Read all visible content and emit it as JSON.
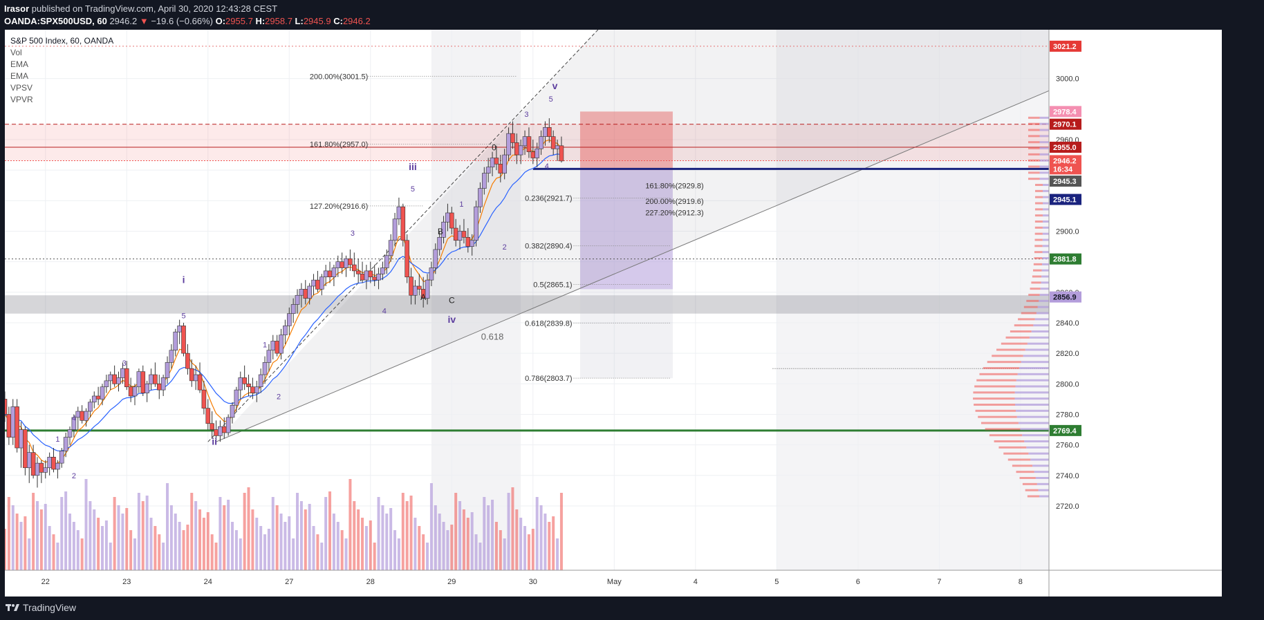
{
  "header": {
    "author": "Irasor",
    "published_text": "published on TradingView.com, April 30, 2020 12:43:28 CEST",
    "symbol": "OANDA:SPX500USD, 60",
    "last": "2946.2",
    "change_arrow": "▼",
    "change": "−19.6 (−0.66%)",
    "o_label": "O:",
    "o": "2955.7",
    "h_label": "H:",
    "h": "2958.7",
    "l_label": "L:",
    "l": "2945.9",
    "c_label": "C:",
    "c": "2946.2"
  },
  "legend": {
    "title": "S&P 500 Index, 60, OANDA",
    "indicators": [
      "Vol",
      "EMA",
      "EMA",
      "VPSV",
      "VPVR"
    ]
  },
  "footer": {
    "brand": "TradingView"
  },
  "colors": {
    "up": "#b39ddb",
    "down": "#ef5350",
    "wave": "#5c3d9e",
    "ema_fast": "#f57c00",
    "ema_slow": "#2962ff",
    "green_line": "#2e7d32",
    "navy_line": "#1a237e"
  },
  "chart_data": {
    "type": "candlestick",
    "title": "S&P 500 Index, 60, OANDA",
    "y_axis": {
      "range": [
        2715,
        3032
      ],
      "ticks": [
        2720,
        2740,
        2760,
        2780,
        2800,
        2820,
        2840,
        2860,
        2880,
        2900,
        2920,
        2940,
        2960,
        3000
      ]
    },
    "x_axis": {
      "ticks": [
        {
          "label": "22",
          "day": 0
        },
        {
          "label": "23",
          "day": 1
        },
        {
          "label": "24",
          "day": 2
        },
        {
          "label": "27",
          "day": 3
        },
        {
          "label": "28",
          "day": 4
        },
        {
          "label": "29",
          "day": 5
        },
        {
          "label": "30",
          "day": 6
        },
        {
          "label": "May",
          "day": 7
        },
        {
          "label": "4",
          "day": 8
        },
        {
          "label": "5",
          "day": 9
        },
        {
          "label": "6",
          "day": 10
        },
        {
          "label": "7",
          "day": 11
        },
        {
          "label": "8",
          "day": 12
        }
      ],
      "day_range": [
        -0.5,
        12.35
      ]
    },
    "price_tags": [
      {
        "label": "3021.2",
        "value": 3021.2,
        "bg": "#e53935",
        "fg": "#ffffff"
      },
      {
        "label": "2978.4",
        "value": 2978.4,
        "bg": "#f48fb1",
        "fg": "#ffffff"
      },
      {
        "label": "2970.1",
        "value": 2970.1,
        "bg": "#b71c1c",
        "fg": "#ffffff"
      },
      {
        "label": "2955.0",
        "value": 2955.0,
        "bg": "#b71c1c",
        "fg": "#ffffff"
      },
      {
        "label": "2946.2",
        "value": 2946.2,
        "bg": "#ef5350",
        "fg": "#ffffff"
      },
      {
        "label": "16:34",
        "value": 2940.8,
        "bg": "#ef5350",
        "fg": "#ffffff"
      },
      {
        "label": "2945.3",
        "value": 2932.8,
        "bg": "#555555",
        "fg": "#ffffff"
      },
      {
        "label": "2945.1",
        "value": 2920.8,
        "bg": "#1a237e",
        "fg": "#ffffff"
      },
      {
        "label": "2881.8",
        "value": 2881.8,
        "bg": "#2e7d32",
        "fg": "#ffffff"
      },
      {
        "label": "2856.9",
        "value": 2856.9,
        "bg": "#b39ddb",
        "fg": "#131722"
      },
      {
        "label": "2769.4",
        "value": 2769.4,
        "bg": "#2e7d32",
        "fg": "#ffffff"
      }
    ],
    "fib_levels": [
      {
        "label": "200.00%(3001.5)",
        "value": 3001.5,
        "x0": 3.97,
        "x1": 5.8
      },
      {
        "label": "161.80%(2957.0)",
        "value": 2957.0,
        "x0": 3.97,
        "x1": 5.6
      },
      {
        "label": "127.20%(2916.6)",
        "value": 2916.6,
        "x0": 3.97,
        "x1": 4.65
      },
      {
        "label": "161.80%(2929.8)",
        "value": 2929.8,
        "x0": 7.4,
        "x1": 7.72
      },
      {
        "label": "200.00%(2919.6)",
        "value": 2919.6,
        "x0": 7.4,
        "x1": 7.72
      },
      {
        "label": "227.20%(2912.3)",
        "value": 2912.3,
        "x0": 7.4,
        "x1": 7.72
      },
      {
        "label": "0.236(2921.7)",
        "value": 2921.7,
        "x0": 6.5,
        "x1": 7.7
      },
      {
        "label": "0.382(2890.4)",
        "value": 2890.4,
        "x0": 6.5,
        "x1": 7.7
      },
      {
        "label": "0.5(2865.1)",
        "value": 2865.1,
        "x0": 6.5,
        "x1": 7.7
      },
      {
        "label": "0.618(2839.8)",
        "value": 2839.8,
        "x0": 6.5,
        "x1": 7.7
      },
      {
        "label": "0.786(2803.7)",
        "value": 2803.7,
        "x0": 6.5,
        "x1": 7.7
      }
    ],
    "wave_labels": [
      {
        "text": "i",
        "day": 1.7,
        "value": 2866
      },
      {
        "text": "ii",
        "day": 2.08,
        "value": 2760
      },
      {
        "text": "iii",
        "day": 4.52,
        "value": 2940
      },
      {
        "text": "iv",
        "day": 5.0,
        "value": 2840
      },
      {
        "text": "v",
        "day": 6.27,
        "value": 2993
      },
      {
        "text": "5",
        "day": 1.7,
        "value": 2843
      },
      {
        "text": "3",
        "day": 0.97,
        "value": 2812
      },
      {
        "text": "4",
        "day": 0.35,
        "value": 2776
      },
      {
        "text": "1",
        "day": 0.15,
        "value": 2762
      },
      {
        "text": "2",
        "day": 0.35,
        "value": 2738
      },
      {
        "text": "1",
        "day": 2.7,
        "value": 2824
      },
      {
        "text": "2",
        "day": 2.87,
        "value": 2790
      },
      {
        "text": "3",
        "day": 3.78,
        "value": 2897
      },
      {
        "text": "4",
        "day": 4.17,
        "value": 2846
      },
      {
        "text": "5",
        "day": 4.52,
        "value": 2926
      },
      {
        "text": "1",
        "day": 5.12,
        "value": 2916
      },
      {
        "text": "2",
        "day": 5.65,
        "value": 2888
      },
      {
        "text": "3",
        "day": 5.92,
        "value": 2975
      },
      {
        "text": "4",
        "day": 6.17,
        "value": 2941
      },
      {
        "text": "5",
        "day": 6.22,
        "value": 2985
      }
    ],
    "abc_labels": [
      {
        "text": "A",
        "day": 4.65,
        "value": 2855
      },
      {
        "text": "B",
        "day": 4.86,
        "value": 2898
      },
      {
        "text": "C",
        "day": 5.0,
        "value": 2853
      },
      {
        "text": "0",
        "day": 5.52,
        "value": 2953
      }
    ],
    "fib_0618_label": {
      "text": "0.618",
      "day": 5.5,
      "value": 2829
    },
    "ohlc": [
      [
        -0.5,
        2790,
        2795,
        2775,
        2780
      ],
      [
        -0.45,
        2780,
        2785,
        2760,
        2765
      ],
      [
        -0.4,
        2765,
        2790,
        2760,
        2785
      ],
      [
        -0.35,
        2785,
        2790,
        2755,
        2758
      ],
      [
        -0.3,
        2758,
        2775,
        2745,
        2770
      ],
      [
        -0.25,
        2770,
        2772,
        2740,
        2745
      ],
      [
        -0.2,
        2745,
        2760,
        2735,
        2755
      ],
      [
        -0.15,
        2755,
        2760,
        2738,
        2740
      ],
      [
        -0.1,
        2740,
        2752,
        2732,
        2748
      ],
      [
        -0.05,
        2748,
        2750,
        2735,
        2742
      ],
      [
        0.0,
        2742,
        2750,
        2738,
        2745
      ],
      [
        0.05,
        2745,
        2755,
        2740,
        2752
      ],
      [
        0.1,
        2752,
        2758,
        2742,
        2744
      ],
      [
        0.15,
        2744,
        2750,
        2738,
        2748
      ],
      [
        0.2,
        2748,
        2758,
        2745,
        2756
      ],
      [
        0.25,
        2756,
        2768,
        2752,
        2765
      ],
      [
        0.3,
        2765,
        2772,
        2760,
        2770
      ],
      [
        0.35,
        2770,
        2780,
        2765,
        2778
      ],
      [
        0.4,
        2778,
        2785,
        2770,
        2782
      ],
      [
        0.45,
        2782,
        2786,
        2774,
        2776
      ],
      [
        0.5,
        2776,
        2784,
        2772,
        2782
      ],
      [
        0.55,
        2782,
        2790,
        2778,
        2788
      ],
      [
        0.6,
        2788,
        2795,
        2784,
        2792
      ],
      [
        0.65,
        2792,
        2798,
        2786,
        2790
      ],
      [
        0.7,
        2790,
        2800,
        2786,
        2798
      ],
      [
        0.75,
        2798,
        2806,
        2794,
        2802
      ],
      [
        0.8,
        2802,
        2808,
        2796,
        2806
      ],
      [
        0.85,
        2806,
        2812,
        2798,
        2800
      ],
      [
        0.9,
        2800,
        2808,
        2795,
        2804
      ],
      [
        0.95,
        2804,
        2814,
        2800,
        2810
      ],
      [
        1.0,
        2810,
        2815,
        2796,
        2798
      ],
      [
        1.05,
        2798,
        2804,
        2788,
        2792
      ],
      [
        1.1,
        2792,
        2800,
        2786,
        2798
      ],
      [
        1.15,
        2798,
        2810,
        2794,
        2808
      ],
      [
        1.2,
        2808,
        2812,
        2792,
        2794
      ],
      [
        1.25,
        2794,
        2802,
        2788,
        2800
      ],
      [
        1.3,
        2800,
        2810,
        2796,
        2806
      ],
      [
        1.35,
        2806,
        2814,
        2798,
        2800
      ],
      [
        1.4,
        2800,
        2806,
        2790,
        2796
      ],
      [
        1.45,
        2796,
        2806,
        2792,
        2804
      ],
      [
        1.5,
        2804,
        2818,
        2800,
        2814
      ],
      [
        1.55,
        2814,
        2826,
        2810,
        2822
      ],
      [
        1.6,
        2822,
        2836,
        2818,
        2834
      ],
      [
        1.65,
        2834,
        2842,
        2826,
        2838
      ],
      [
        1.7,
        2838,
        2840,
        2818,
        2820
      ],
      [
        1.75,
        2820,
        2826,
        2806,
        2810
      ],
      [
        1.8,
        2810,
        2816,
        2798,
        2802
      ],
      [
        1.85,
        2802,
        2812,
        2796,
        2806
      ],
      [
        1.9,
        2806,
        2814,
        2794,
        2796
      ],
      [
        1.95,
        2796,
        2802,
        2780,
        2784
      ],
      [
        2.0,
        2784,
        2790,
        2770,
        2774
      ],
      [
        2.05,
        2774,
        2782,
        2764,
        2770
      ],
      [
        2.1,
        2770,
        2776,
        2760,
        2766
      ],
      [
        2.15,
        2766,
        2776,
        2762,
        2772
      ],
      [
        2.2,
        2772,
        2778,
        2764,
        2768
      ],
      [
        2.25,
        2768,
        2780,
        2766,
        2778
      ],
      [
        2.3,
        2778,
        2788,
        2774,
        2786
      ],
      [
        2.35,
        2786,
        2798,
        2782,
        2796
      ],
      [
        2.4,
        2796,
        2808,
        2790,
        2804
      ],
      [
        2.45,
        2804,
        2812,
        2796,
        2800
      ],
      [
        2.5,
        2800,
        2806,
        2792,
        2798
      ],
      [
        2.55,
        2798,
        2804,
        2790,
        2794
      ],
      [
        2.6,
        2794,
        2802,
        2788,
        2798
      ],
      [
        2.65,
        2798,
        2810,
        2794,
        2806
      ],
      [
        2.7,
        2806,
        2818,
        2800,
        2814
      ],
      [
        2.75,
        2814,
        2826,
        2808,
        2822
      ],
      [
        2.8,
        2822,
        2832,
        2816,
        2828
      ],
      [
        2.85,
        2828,
        2832,
        2818,
        2820
      ],
      [
        2.9,
        2820,
        2836,
        2816,
        2832
      ],
      [
        2.95,
        2832,
        2842,
        2826,
        2838
      ],
      [
        3.0,
        2838,
        2850,
        2832,
        2846
      ],
      [
        3.05,
        2846,
        2856,
        2840,
        2852
      ],
      [
        3.1,
        2852,
        2862,
        2846,
        2858
      ],
      [
        3.15,
        2858,
        2866,
        2850,
        2862
      ],
      [
        3.2,
        2862,
        2868,
        2852,
        2856
      ],
      [
        3.25,
        2856,
        2866,
        2852,
        2864
      ],
      [
        3.3,
        2864,
        2872,
        2858,
        2868
      ],
      [
        3.35,
        2868,
        2874,
        2860,
        2862
      ],
      [
        3.4,
        2862,
        2872,
        2858,
        2870
      ],
      [
        3.45,
        2870,
        2878,
        2864,
        2874
      ],
      [
        3.5,
        2874,
        2880,
        2866,
        2870
      ],
      [
        3.55,
        2870,
        2878,
        2864,
        2876
      ],
      [
        3.6,
        2876,
        2884,
        2870,
        2880
      ],
      [
        3.65,
        2880,
        2886,
        2872,
        2876
      ],
      [
        3.7,
        2876,
        2884,
        2870,
        2882
      ],
      [
        3.75,
        2882,
        2888,
        2874,
        2878
      ],
      [
        3.8,
        2878,
        2886,
        2870,
        2874
      ],
      [
        3.85,
        2874,
        2882,
        2866,
        2872
      ],
      [
        3.9,
        2872,
        2880,
        2866,
        2868
      ],
      [
        3.95,
        2868,
        2878,
        2862,
        2874
      ],
      [
        4.0,
        2874,
        2880,
        2866,
        2870
      ],
      [
        4.05,
        2870,
        2878,
        2864,
        2868
      ],
      [
        4.1,
        2868,
        2876,
        2862,
        2872
      ],
      [
        4.15,
        2872,
        2880,
        2868,
        2876
      ],
      [
        4.2,
        2876,
        2888,
        2872,
        2884
      ],
      [
        4.25,
        2884,
        2898,
        2880,
        2894
      ],
      [
        4.3,
        2894,
        2912,
        2890,
        2908
      ],
      [
        4.35,
        2908,
        2922,
        2904,
        2916
      ],
      [
        4.4,
        2916,
        2918,
        2890,
        2894
      ],
      [
        4.45,
        2894,
        2898,
        2866,
        2870
      ],
      [
        4.5,
        2870,
        2876,
        2852,
        2858
      ],
      [
        4.55,
        2858,
        2868,
        2852,
        2864
      ],
      [
        4.6,
        2864,
        2872,
        2858,
        2862
      ],
      [
        4.65,
        2862,
        2870,
        2850,
        2856
      ],
      [
        4.7,
        2856,
        2872,
        2852,
        2868
      ],
      [
        4.75,
        2868,
        2880,
        2864,
        2876
      ],
      [
        4.8,
        2876,
        2892,
        2872,
        2888
      ],
      [
        4.85,
        2888,
        2900,
        2884,
        2896
      ],
      [
        4.9,
        2896,
        2910,
        2892,
        2906
      ],
      [
        4.95,
        2906,
        2918,
        2900,
        2912
      ],
      [
        5.0,
        2912,
        2916,
        2898,
        2902
      ],
      [
        5.05,
        2902,
        2908,
        2890,
        2894
      ],
      [
        5.1,
        2894,
        2904,
        2888,
        2900
      ],
      [
        5.15,
        2900,
        2908,
        2892,
        2896
      ],
      [
        5.2,
        2896,
        2902,
        2886,
        2890
      ],
      [
        5.25,
        2890,
        2898,
        2884,
        2894
      ],
      [
        5.3,
        2894,
        2920,
        2890,
        2916
      ],
      [
        5.35,
        2916,
        2932,
        2912,
        2928
      ],
      [
        5.4,
        2928,
        2942,
        2924,
        2938
      ],
      [
        5.45,
        2938,
        2948,
        2932,
        2942
      ],
      [
        5.5,
        2942,
        2952,
        2936,
        2948
      ],
      [
        5.55,
        2948,
        2956,
        2940,
        2944
      ],
      [
        5.6,
        2944,
        2950,
        2932,
        2938
      ],
      [
        5.65,
        2938,
        2954,
        2934,
        2950
      ],
      [
        5.7,
        2950,
        2968,
        2946,
        2964
      ],
      [
        5.75,
        2964,
        2972,
        2954,
        2958
      ],
      [
        5.8,
        2958,
        2964,
        2944,
        2950
      ],
      [
        5.85,
        2950,
        2960,
        2944,
        2956
      ],
      [
        5.9,
        2956,
        2966,
        2950,
        2962
      ],
      [
        5.95,
        2962,
        2968,
        2948,
        2952
      ],
      [
        6.0,
        2952,
        2960,
        2944,
        2948
      ],
      [
        6.05,
        2948,
        2958,
        2942,
        2954
      ],
      [
        6.1,
        2954,
        2966,
        2950,
        2962
      ],
      [
        6.15,
        2962,
        2972,
        2956,
        2968
      ],
      [
        6.2,
        2968,
        2974,
        2958,
        2962
      ],
      [
        6.25,
        2962,
        2966,
        2950,
        2954
      ],
      [
        6.3,
        2954,
        2960,
        2946,
        2956
      ],
      [
        6.35,
        2956,
        2962,
        2945,
        2946
      ]
    ]
  }
}
